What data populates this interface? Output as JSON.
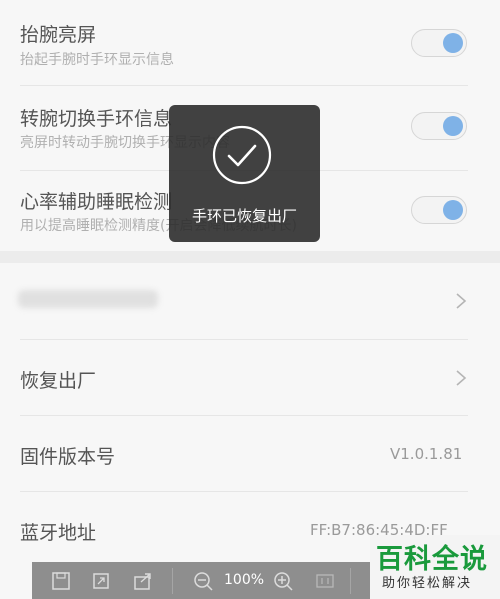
{
  "settings": [
    {
      "title": "抬腕亮屏",
      "subtitle": "抬起手腕时手环显示信息"
    },
    {
      "title": "转腕切换手环信息",
      "subtitle": "亮屏时转动手腕切换手环显示内容"
    },
    {
      "title": "心率辅助睡眠检测",
      "subtitle": "用以提高睡眠检测精度(开启会降低续航时长)"
    }
  ],
  "list": {
    "reset_label": "恢复出厂",
    "firmware_label": "固件版本号",
    "firmware_value": "V1.0.1.81",
    "bluetooth_label": "蓝牙地址",
    "bluetooth_value": "FF:B7:86:45:4D:FF"
  },
  "toast": {
    "message": "手环已恢复出厂"
  },
  "toolbar": {
    "zoom": "100%"
  },
  "watermark": {
    "title": "百科全说",
    "subtitle": "助你轻松解决"
  },
  "colors": {
    "accent": "#7fb2e7",
    "brand": "#1a9a3c"
  }
}
